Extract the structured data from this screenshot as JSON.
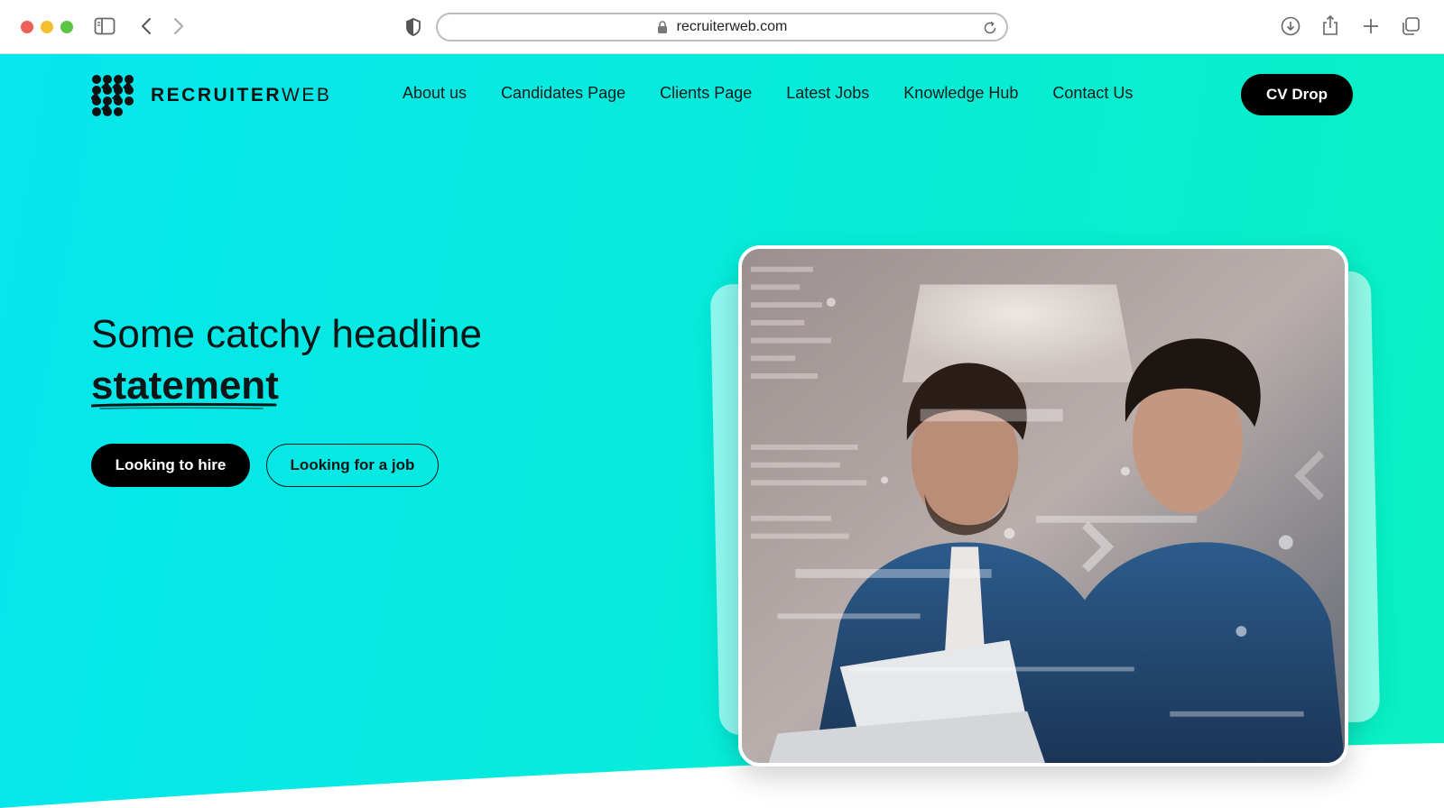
{
  "browser": {
    "url": "recruiterweb.com"
  },
  "site": {
    "logo": {
      "bold": "RECRUITER",
      "light": "WEB"
    },
    "nav": [
      {
        "label": "About us"
      },
      {
        "label": "Candidates Page"
      },
      {
        "label": "Clients Page"
      },
      {
        "label": "Latest Jobs"
      },
      {
        "label": "Knowledge Hub"
      },
      {
        "label": "Contact Us"
      }
    ],
    "cta": "CV Drop"
  },
  "hero": {
    "headline_line1": "Some catchy headline",
    "headline_line2": "statement",
    "primary_button": "Looking to hire",
    "secondary_button": "Looking for a job"
  },
  "colors": {
    "gradient_start": "#05e6ee",
    "gradient_end": "#0af0c2",
    "button_dark": "#000000"
  }
}
